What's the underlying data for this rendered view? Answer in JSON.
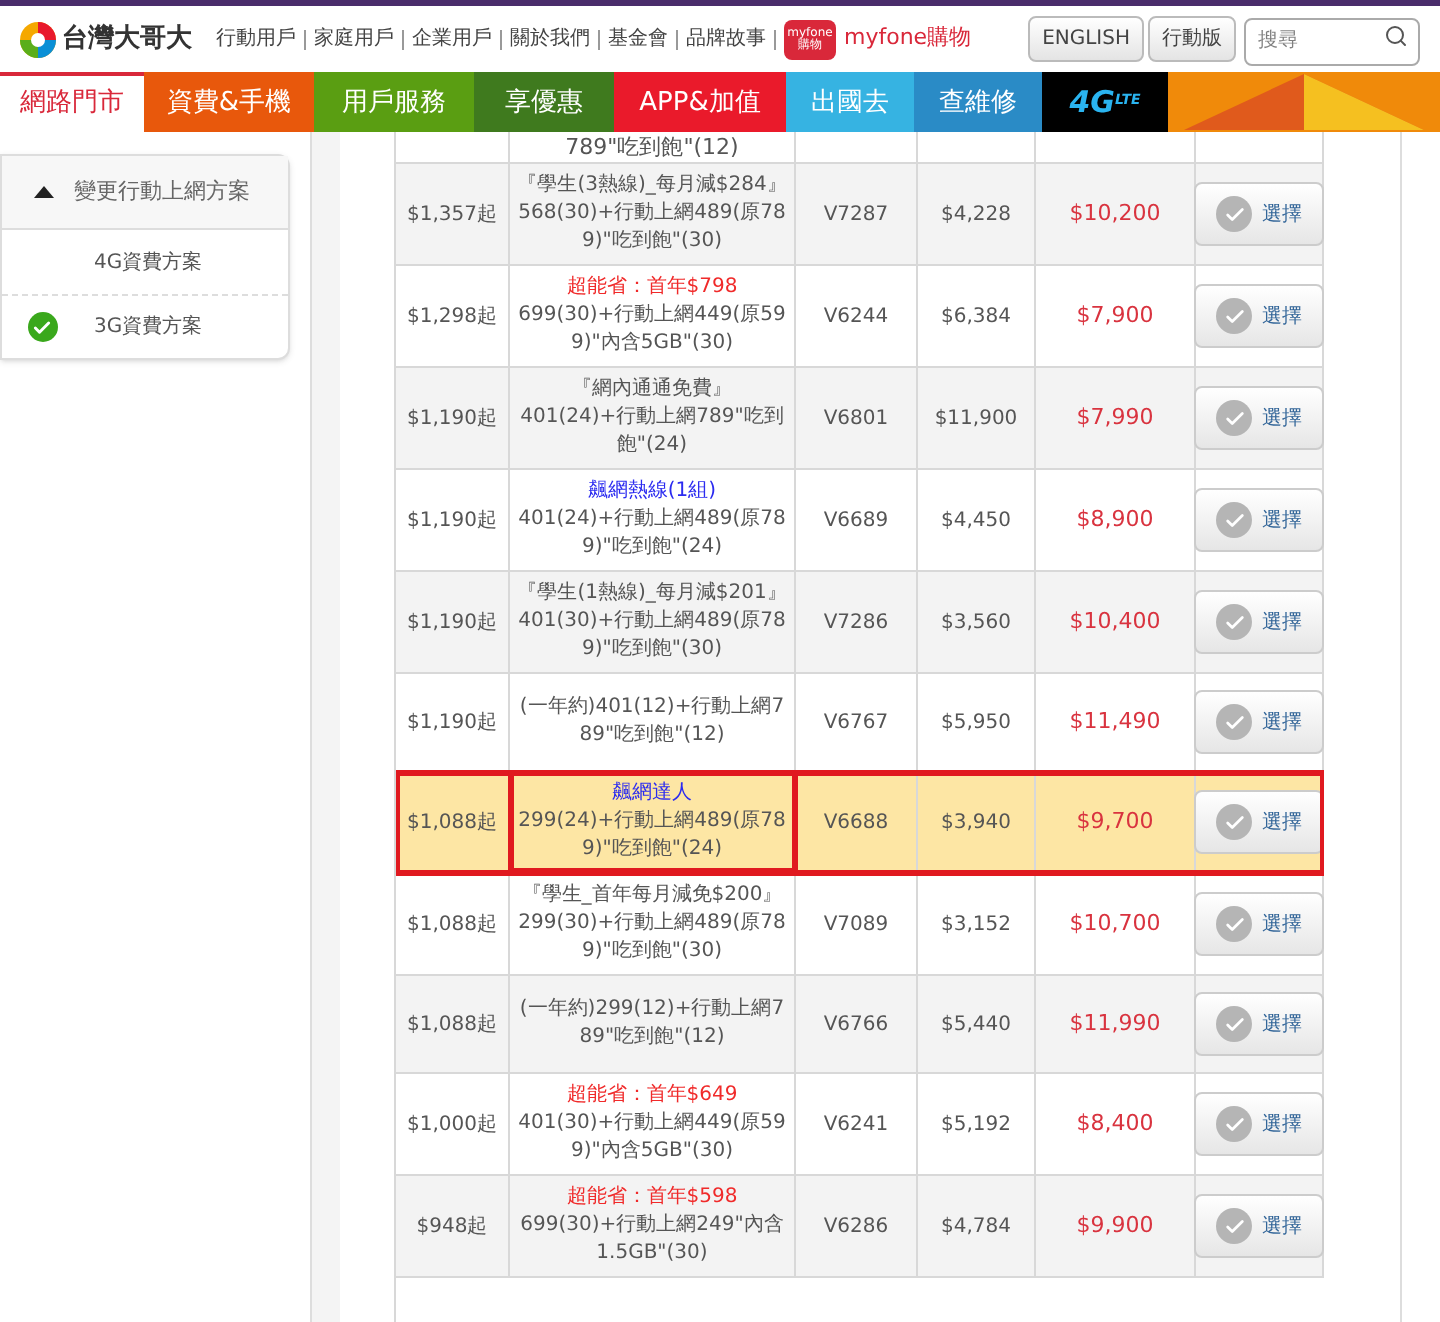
{
  "header": {
    "logo_text": "台灣大哥大",
    "links": [
      "行動用戶",
      "家庭用戶",
      "企業用戶",
      "關於我們",
      "基金會",
      "品牌故事"
    ],
    "shop": {
      "badge_top": "myfone",
      "badge_bottom": "購物",
      "label": "myfone購物"
    },
    "buttons": [
      "ENGLISH",
      "行動版"
    ],
    "search": {
      "placeholder": "搜尋"
    }
  },
  "nav": [
    {
      "kind": "text",
      "label": "網路門市",
      "color": "#ffffff",
      "selected": true
    },
    {
      "kind": "text",
      "label": "資費&手機",
      "color": "#e8580c",
      "selected": false
    },
    {
      "kind": "text",
      "label": "用戶服務",
      "color": "#5a9e12",
      "selected": false
    },
    {
      "kind": "text",
      "label": "享優惠",
      "color": "#3f7a1e",
      "selected": false
    },
    {
      "kind": "text",
      "label": "APP&加值",
      "color": "#ea1a2b",
      "selected": false
    },
    {
      "kind": "text",
      "label": "出國去",
      "color": "#36b3e2",
      "selected": false
    },
    {
      "kind": "text",
      "label": "查維修",
      "color": "#2a8bc6",
      "selected": false
    },
    {
      "kind": "lte",
      "label": "4G",
      "sup": "LTE",
      "color": "#000000",
      "selected": false
    }
  ],
  "banner": {
    "color": "#f08a0a"
  },
  "sidebar": {
    "title": "變更行動上網方案",
    "expanded": true,
    "items": [
      {
        "label": "4G資費方案",
        "selected": false
      },
      {
        "label": "3G資費方案",
        "selected": true
      }
    ]
  },
  "table": {
    "partial_row": {
      "plan": "789\"吃到飽\"(12)"
    },
    "rows": [
      {
        "price_from": "$1,357起",
        "tag": {
          "kind": "plain",
          "text": "『學生(3熱線)_每月減$284』"
        },
        "plan": "568(30)+行動上網489(原789)\"吃到飽\"(30)",
        "code": "V7287",
        "device_price": "$4,228",
        "price": "$10,200",
        "button": "選擇",
        "selected": false
      },
      {
        "price_from": "$1,298起",
        "tag": {
          "kind": "promo",
          "text": "超能省：首年$798"
        },
        "plan": "699(30)+行動上網449(原599)\"內含5GB\"(30)",
        "code": "V6244",
        "device_price": "$6,384",
        "price": "$7,900",
        "button": "選擇",
        "selected": false
      },
      {
        "price_from": "$1,190起",
        "tag": {
          "kind": "plain",
          "text": "『網內通通免費』"
        },
        "plan": "401(24)+行動上網789\"吃到飽\"(24)",
        "code": "V6801",
        "device_price": "$11,900",
        "price": "$7,990",
        "button": "選擇",
        "selected": false
      },
      {
        "price_from": "$1,190起",
        "tag": {
          "kind": "hot",
          "text": "飆網熱線(1組)"
        },
        "plan": "401(24)+行動上網489(原789)\"吃到飽\"(24)",
        "code": "V6689",
        "device_price": "$4,450",
        "price": "$8,900",
        "button": "選擇",
        "selected": false
      },
      {
        "price_from": "$1,190起",
        "tag": {
          "kind": "plain",
          "text": "『學生(1熱線)_每月減$201』"
        },
        "plan": "401(30)+行動上網489(原789)\"吃到飽\"(30)",
        "code": "V7286",
        "device_price": "$3,560",
        "price": "$10,400",
        "button": "選擇",
        "selected": false
      },
      {
        "price_from": "$1,190起",
        "plan": "(一年約)401(12)+行動上網789\"吃到飽\"(12)",
        "code": "V6767",
        "device_price": "$5,950",
        "price": "$11,490",
        "button": "選擇",
        "selected": false
      },
      {
        "price_from": "$1,088起",
        "tag": {
          "kind": "hot",
          "text": "飆網達人"
        },
        "plan": "299(24)+行動上網489(原789)\"吃到飽\"(24)",
        "code": "V6688",
        "device_price": "$3,940",
        "price": "$9,700",
        "button": "選擇",
        "selected": true
      },
      {
        "price_from": "$1,088起",
        "tag": {
          "kind": "plain",
          "text": "『學生_首年每月減免$200』"
        },
        "plan": "299(30)+行動上網489(原789)\"吃到飽\"(30)",
        "code": "V7089",
        "device_price": "$3,152",
        "price": "$10,700",
        "button": "選擇",
        "selected": false
      },
      {
        "price_from": "$1,088起",
        "plan": "(一年約)299(12)+行動上網789\"吃到飽\"(12)",
        "code": "V6766",
        "device_price": "$5,440",
        "price": "$11,990",
        "button": "選擇",
        "selected": false
      },
      {
        "price_from": "$1,000起",
        "tag": {
          "kind": "promo",
          "text": "超能省：首年$649"
        },
        "plan": "401(30)+行動上網449(原599)\"內含5GB\"(30)",
        "code": "V6241",
        "device_price": "$5,192",
        "price": "$8,400",
        "button": "選擇",
        "selected": false
      },
      {
        "price_from": "$948起",
        "tag": {
          "kind": "promo",
          "text": "超能省：首年$598"
        },
        "plan": "699(30)+行動上網249\"內含1.5GB\"(30)",
        "code": "V6286",
        "device_price": "$4,784",
        "price": "$9,900",
        "button": "選擇",
        "selected": false
      }
    ]
  }
}
